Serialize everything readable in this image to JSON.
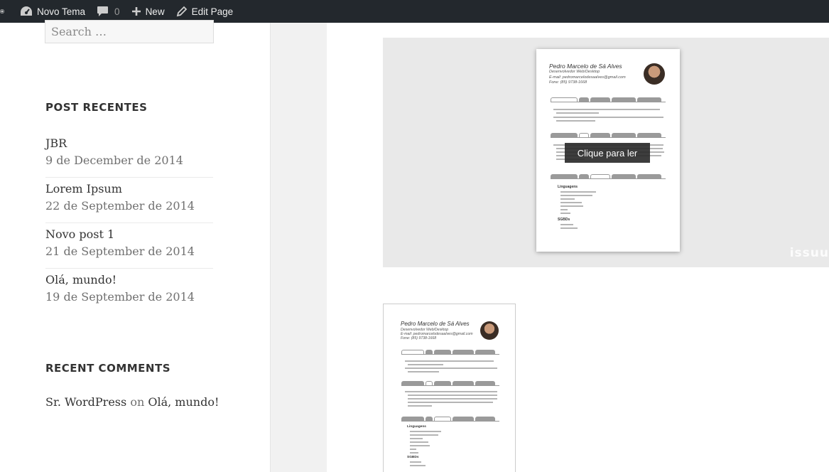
{
  "adminbar": {
    "site_name": "Novo Tema",
    "comments_count": "0",
    "new_label": "New",
    "edit_label": "Edit Page"
  },
  "sidebar": {
    "search_placeholder": "Search …",
    "recent_posts_title": "POST RECENTES",
    "posts": [
      {
        "title": "JBR",
        "date": "9 de December de 2014"
      },
      {
        "title": "Lorem Ipsum",
        "date": "22 de September de 2014"
      },
      {
        "title": "Novo post 1",
        "date": "21 de September de 2014"
      },
      {
        "title": "Olá, mundo!",
        "date": "19 de September de 2014"
      }
    ],
    "recent_comments_title": "RECENT COMMENTS",
    "comment": {
      "author": "Sr. WordPress",
      "on": "on",
      "post": "Olá, mundo!"
    }
  },
  "content": {
    "embed": {
      "overlay_label": "Clique para ler",
      "logo": "issuu"
    },
    "resume": {
      "name": "Pedro Marcelo de Sá Alves",
      "role": "Desenvolvedor Web/Desktop",
      "email": "E-mail: pedromarcelodesaalves@gmail.com",
      "phone": "Fone: (85) 9738-1668",
      "section_languages": "Linguagens",
      "section_db": "SGBDs"
    }
  },
  "colors": {
    "adminbar_bg": "#23282d",
    "page_bg": "#f1f1f1",
    "embed_bg": "#e9e9e9"
  }
}
